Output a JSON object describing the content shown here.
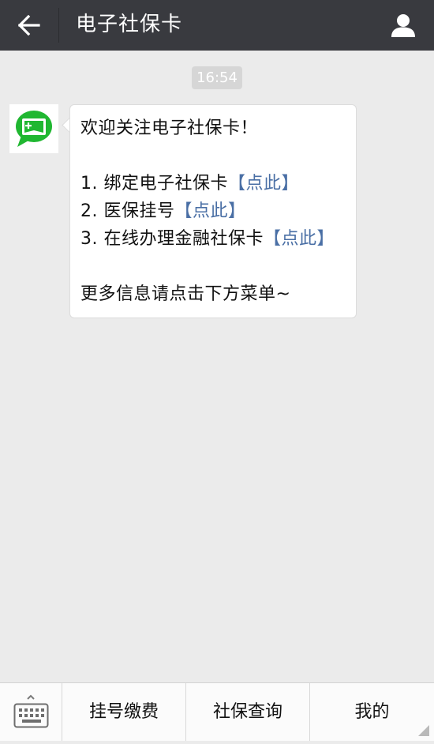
{
  "header": {
    "title": "电子社保卡",
    "back_icon": "arrow-left-icon",
    "profile_icon": "person-icon",
    "bg_color": "#393a3f"
  },
  "chat": {
    "timestamp": "16:54",
    "avatar_icon": "social-security-card-icon",
    "accent_green": "#20b731",
    "message": {
      "welcome": "欢迎关注电子社保卡！",
      "items": [
        {
          "text": "1. 绑定电子社保卡",
          "link": "【点此】"
        },
        {
          "text": "2. 医保挂号",
          "link": "【点此】"
        },
        {
          "text": "3. 在线办理金融社保卡",
          "link": "【点此】"
        }
      ],
      "footer": "更多信息请点击下方菜单~",
      "link_color": "#4a6fa5"
    }
  },
  "menu": {
    "keyboard_icon": "keyboard-icon",
    "items": [
      {
        "label": "挂号缴费"
      },
      {
        "label": "社保查询"
      },
      {
        "label": "我的"
      }
    ]
  }
}
